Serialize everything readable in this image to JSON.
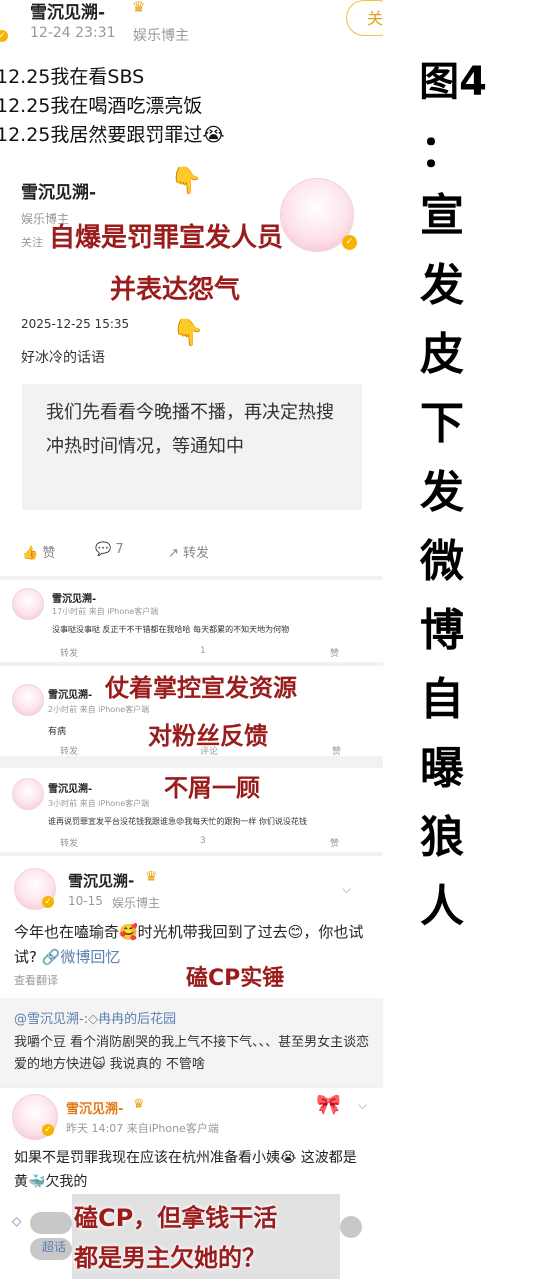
{
  "side_title": [
    "图4",
    "：",
    "宣",
    "发",
    "皮",
    "下",
    "发",
    "微",
    "博",
    "自",
    "曝",
    "狼",
    "人"
  ],
  "post1": {
    "name": "雪沉见溯-",
    "time": "12-24 23:31",
    "tag": "娱乐博主",
    "follow": "关",
    "lines": [
      "12.25我在看SBS",
      "12.25我在喝酒吃漂亮饭",
      "12.25我居然要跟罚罪过😭"
    ]
  },
  "post2": {
    "name": "雪沉见溯-",
    "tag": "娱乐博主",
    "follow_hint": "关注",
    "date": "2025-12-25 15:35",
    "caption": "好冰冷的话语",
    "quote": "我们先看看今晚播不播，再决定热搜冲热时间情况，等通知中",
    "like": "赞",
    "comments": "7",
    "share": "转发",
    "overlay1": "自爆是罚罪宣发人员",
    "overlay2": "并表达怨气"
  },
  "comments": [
    {
      "name": "雪沉见溯-",
      "meta": "17小时前  来自 iPhone客户端",
      "text": "没事哒没事哒 反正干不干错都在我哈哈 每天都累的不知天地为何物",
      "share": "转发",
      "comment": "1",
      "like": "赞"
    },
    {
      "name": "雪沉见溯-",
      "meta": "2小时前  来自 iPhone客户端",
      "text": "有病",
      "share": "转发",
      "comment": "评论",
      "like": "赞"
    },
    {
      "name": "雪沉见溯-",
      "meta": "3小时前  来自 iPhone客户端",
      "text": "谁再说罚罪宣发平台没花钱我跟谁急😡我每天忙的跟狗一样 你们说没花钱",
      "share": "转发",
      "comment": "3",
      "like": "赞"
    }
  ],
  "overlay_mid": [
    "仗着掌控宣发资源",
    "对粉丝反馈",
    "不屑一顾"
  ],
  "post3": {
    "name": "雪沉见溯-",
    "time": "10-15",
    "tag": "娱乐博主",
    "text": "今年也在嗑瑜奇🥰时光机带我回到了过去😊，你也试试?",
    "link": "🔗微博回忆",
    "translate": "查看翻译",
    "overlay": "磕CP实锤",
    "repost_user": "@雪沉见溯-:",
    "repost_source": "冉冉的后花园",
    "repost_text": "我嚼个豆 看个消防剧哭的我上气不接下气、、、甚至男女主谈恋爱的地方快进🙀 我说真的 不管啥"
  },
  "post4": {
    "name": "雪沉见溯-",
    "meta": "昨天 14:07  来自iPhone客户端",
    "text": "如果不是罚罪我现在应该在杭州准备看小姨😭 这波都是黄🐳欠我的",
    "footer": "超话",
    "overlay1": "磕CP，但拿钱干活",
    "overlay2": "都是男主欠她的？"
  }
}
